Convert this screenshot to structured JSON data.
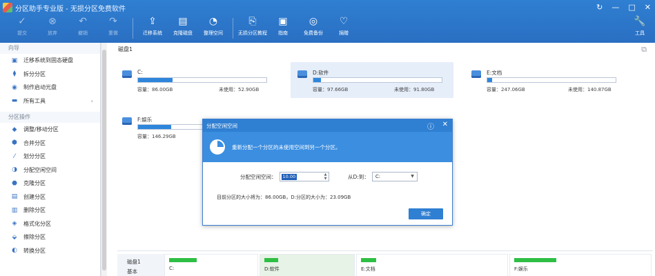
{
  "window": {
    "title": "分区助手专业版 - 无损分区免费软件",
    "controls": [
      "↻",
      "—",
      "□",
      "✕"
    ]
  },
  "toolbar": {
    "items": [
      {
        "label": "提交",
        "icon": "check-icon",
        "disabled": true
      },
      {
        "label": "放弃",
        "icon": "cancel-icon",
        "disabled": true
      },
      {
        "label": "撤销",
        "icon": "undo-icon",
        "disabled": true
      },
      {
        "label": "重做",
        "icon": "redo-icon",
        "disabled": true
      },
      {
        "label": "迁移系统",
        "icon": "migrate-icon",
        "disabled": false
      },
      {
        "label": "克隆磁盘",
        "icon": "clone-disk-icon",
        "disabled": false
      },
      {
        "label": "整理空间",
        "icon": "pie-icon",
        "disabled": false
      },
      {
        "label": "无损分区教程",
        "icon": "tutorial-icon",
        "disabled": false
      },
      {
        "label": "指南",
        "icon": "guide-icon",
        "disabled": false
      },
      {
        "label": "免费备份",
        "icon": "backup-icon",
        "disabled": false
      },
      {
        "label": "捐赠",
        "icon": "heart-icon",
        "disabled": false
      }
    ],
    "tools_label": "工具"
  },
  "sidebar": {
    "section1": "向导",
    "wizard_items": [
      {
        "label": "迁移系统到固态硬盘",
        "icon": "ssd-icon"
      },
      {
        "label": "拆分分区",
        "icon": "split-icon"
      },
      {
        "label": "制作启动光盘",
        "icon": "disc-icon"
      },
      {
        "label": "所有工具",
        "icon": "tools-icon",
        "more": "›"
      }
    ],
    "section2": "分区操作",
    "ops_items": [
      {
        "label": "调整/移动分区",
        "icon": "resize-icon"
      },
      {
        "label": "合并分区",
        "icon": "merge-icon"
      },
      {
        "label": "划分分区",
        "icon": "divide-icon"
      },
      {
        "label": "分配空闲空间",
        "icon": "allocate-icon"
      },
      {
        "label": "克隆分区",
        "icon": "clone-icon"
      },
      {
        "label": "创建分区",
        "icon": "create-icon"
      },
      {
        "label": "删除分区",
        "icon": "delete-icon"
      },
      {
        "label": "格式化分区",
        "icon": "format-icon"
      },
      {
        "label": "擦除分区",
        "icon": "wipe-icon"
      },
      {
        "label": "转换分区",
        "icon": "convert-icon"
      }
    ]
  },
  "main": {
    "disk_title": "磁盘1",
    "partitions": [
      {
        "name": "C:",
        "used_pct": 27,
        "cap": "容量：86.00GB",
        "free": "未使用：52.90GB",
        "selected": false
      },
      {
        "name": "D:软件",
        "used_pct": 6,
        "cap": "容量：97.66GB",
        "free": "未使用：91.80GB",
        "selected": true
      },
      {
        "name": "E:文档",
        "used_pct": 4,
        "cap": "容量：247.06GB",
        "free": "未使用：140.87GB",
        "selected": false
      },
      {
        "name": "F:娱乐",
        "used_pct": 26,
        "cap": "容量：146.29GB",
        "free": "",
        "selected": false
      }
    ]
  },
  "dialog": {
    "title": "分配空闲空间",
    "banner": "重新分配一个分区的未使用空间到另一个分区。",
    "alloc_label": "分配空闲空间：",
    "alloc_value": "10.00",
    "target_label": "从D:到：",
    "target_value": "C:",
    "info": "目前分区的大小将为：86.00GB，D:分区的大小为：23.09GB",
    "ok": "确定"
  },
  "diskmap": {
    "disk_label": "磁盘1",
    "disk_kind": "基本",
    "cells": [
      {
        "label": "C:",
        "used_pct": 30,
        "selected": false
      },
      {
        "label": "D:软件",
        "used_pct": 15,
        "selected": true
      },
      {
        "label": "E:文档",
        "used_pct": 10,
        "selected": false
      },
      {
        "label": "F:娱乐",
        "used_pct": 30,
        "selected": false
      }
    ]
  },
  "colors": {
    "accent": "#2f7fd2",
    "bar_fill": "#2e86db",
    "map_fill": "#2fbf44",
    "selected_bg": "#e6eefa"
  }
}
